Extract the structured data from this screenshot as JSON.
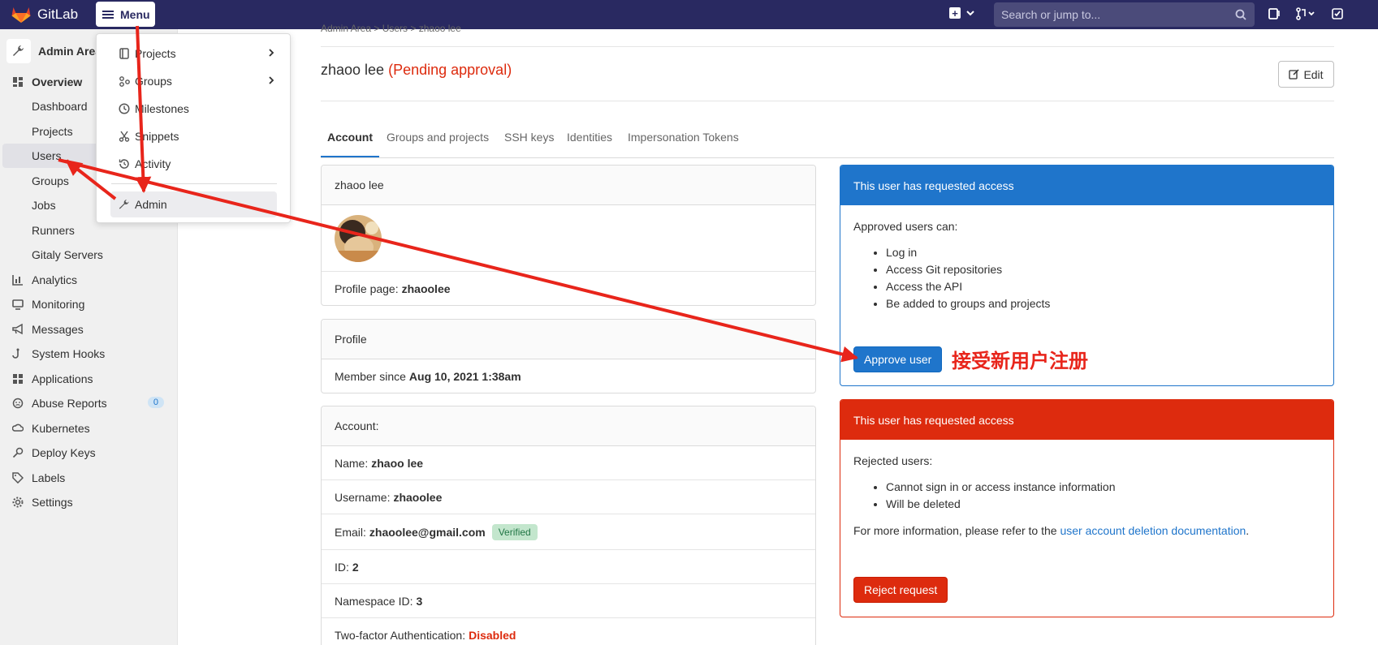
{
  "navbar": {
    "brand": "GitLab",
    "menu_label": "Menu",
    "search_placeholder": "Search or jump to..."
  },
  "sidebar": {
    "title": "Admin Area",
    "items": [
      {
        "label": "Overview",
        "icon": "overview-icon"
      },
      {
        "label": "Dashboard"
      },
      {
        "label": "Projects"
      },
      {
        "label": "Users"
      },
      {
        "label": "Groups"
      },
      {
        "label": "Jobs"
      },
      {
        "label": "Runners"
      },
      {
        "label": "Gitaly Servers"
      },
      {
        "label": "Analytics",
        "icon": "chart-icon"
      },
      {
        "label": "Monitoring",
        "icon": "monitor-icon"
      },
      {
        "label": "Messages",
        "icon": "megaphone-icon"
      },
      {
        "label": "System Hooks",
        "icon": "hook-icon"
      },
      {
        "label": "Applications",
        "icon": "apps-icon"
      },
      {
        "label": "Abuse Reports",
        "icon": "abuse-icon",
        "count": "0"
      },
      {
        "label": "Kubernetes",
        "icon": "kubernetes-icon"
      },
      {
        "label": "Deploy Keys",
        "icon": "key-icon"
      },
      {
        "label": "Labels",
        "icon": "label-icon"
      },
      {
        "label": "Settings",
        "icon": "settings-icon"
      }
    ]
  },
  "menu_dropdown": {
    "items": [
      {
        "label": "Projects"
      },
      {
        "label": "Groups"
      },
      {
        "label": "Milestones"
      },
      {
        "label": "Snippets"
      },
      {
        "label": "Activity"
      },
      {
        "label": "Admin"
      }
    ]
  },
  "breadcrumb": "Admin Area  >  Users  >  zhaoo lee",
  "page": {
    "user_name": "zhaoo lee",
    "status": "(Pending approval)",
    "edit_label": "Edit"
  },
  "tabs": [
    "Account",
    "Groups and projects",
    "SSH keys",
    "Identities",
    "Impersonation Tokens"
  ],
  "profile_card": {
    "header": "zhaoo lee",
    "profile_page_label": "Profile page:",
    "profile_page_value": "zhaoolee"
  },
  "profile_section": {
    "header": "Profile",
    "member_since_label": "Member since",
    "member_since_value": "Aug 10, 2021 1:38am"
  },
  "account_section": {
    "header": "Account:",
    "name_label": "Name:",
    "name_value": "zhaoo lee",
    "username_label": "Username:",
    "username_value": "zhaoolee",
    "email_label": "Email:",
    "email_value": "zhaoolee@gmail.com",
    "verified_badge": "Verified",
    "id_label": "ID:",
    "id_value": "2",
    "namespace_label": "Namespace ID:",
    "namespace_value": "3",
    "twofa_label": "Two-factor Authentication:",
    "twofa_value": "Disabled"
  },
  "approve_panel": {
    "header": "This user has requested access",
    "intro": "Approved users can:",
    "items": [
      "Log in",
      "Access Git repositories",
      "Access the API",
      "Be added to groups and projects"
    ],
    "button": "Approve user",
    "annotation": "接受新用户注册"
  },
  "reject_panel": {
    "header": "This user has requested access",
    "intro": "Rejected users:",
    "items": [
      "Cannot sign in or access instance information",
      "Will be deleted"
    ],
    "info_text": "For more information, please refer to the",
    "link_text": "user account deletion documentation",
    "info_end": ".",
    "button": "Reject request"
  },
  "colors": {
    "navbar_bg": "#292961",
    "approve_header": "#1f75cb",
    "reject_header": "#dd2b0e",
    "annotation_arrow": "#e8251b"
  }
}
